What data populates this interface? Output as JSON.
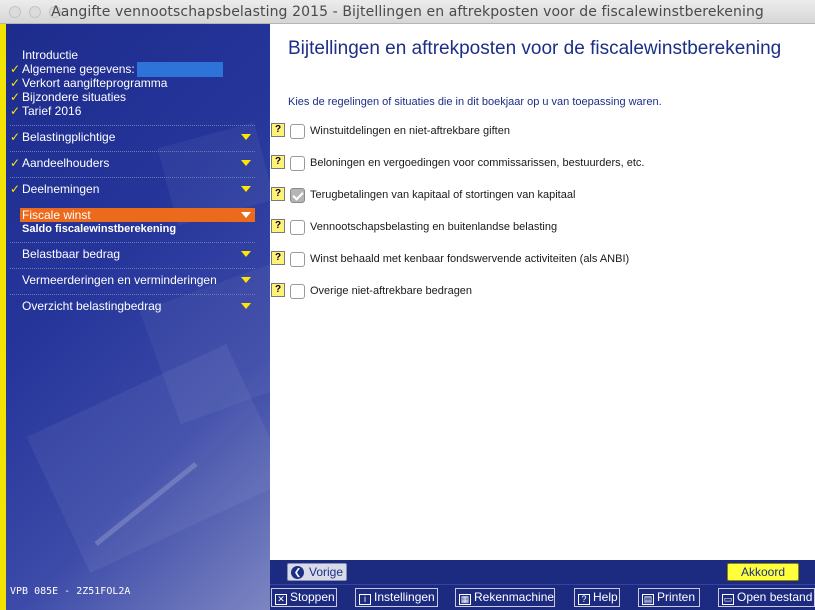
{
  "window": {
    "title": "Aangifte vennootschapsbelasting 2015 - Bijtellingen en aftrekposten voor de fiscalewinstberekening"
  },
  "sidebar": {
    "intro_items": [
      {
        "label": "Introductie",
        "checked": false
      },
      {
        "label": "Algemene gegevens:",
        "checked": true
      },
      {
        "label": "Verkort aangifteprogramma",
        "checked": true
      },
      {
        "label": "Bijzondere situaties",
        "checked": true
      },
      {
        "label": "Tarief 2016",
        "checked": true
      }
    ],
    "sections": [
      {
        "label": "Belastingplichtige",
        "checked": true
      },
      {
        "label": "Aandeelhouders",
        "checked": true
      },
      {
        "label": "Deelnemingen",
        "checked": true
      }
    ],
    "active_section": {
      "label": "Fiscale winst",
      "sub_label": "Saldo fiscalewinstberekening"
    },
    "lower_sections": [
      {
        "label": "Belastbaar bedrag"
      },
      {
        "label": "Vermeerderingen en verminderingen"
      },
      {
        "label": "Overzicht belastingbedrag"
      }
    ],
    "version": "VPB 085E - 2Z51FOL2A"
  },
  "main": {
    "title": "Bijtellingen en aftrekposten voor de fiscalewinstberekening",
    "instruction": "Kies de regelingen of situaties die in dit boekjaar op u van toepassing waren.",
    "help_label": "?",
    "options": [
      {
        "label": "Winstuitdelingen en niet-aftrekbare giften",
        "checked": false
      },
      {
        "label": "Beloningen en vergoedingen voor commissarissen, bestuurders, etc.",
        "checked": false
      },
      {
        "label": "Terugbetalingen van kapitaal of stortingen van kapitaal",
        "checked": true
      },
      {
        "label": "Vennootschapsbelasting en buitenlandse belasting",
        "checked": false
      },
      {
        "label": "Winst behaald met kenbaar fondswervende activiteiten (als ANBI)",
        "checked": false
      },
      {
        "label": "Overige niet-aftrekbare bedragen",
        "checked": false
      }
    ]
  },
  "navigation": {
    "prev_label": "Vorige",
    "ok_label": "Akkoord"
  },
  "toolbar": {
    "buttons": [
      {
        "label": "Stoppen",
        "icon": "x-box-icon"
      },
      {
        "label": "Instellingen",
        "icon": "info-icon"
      },
      {
        "label": "Rekenmachine",
        "icon": "calculator-icon"
      },
      {
        "label": "Help",
        "icon": "help-icon"
      },
      {
        "label": "Printen",
        "icon": "printer-icon"
      },
      {
        "label": "Open bestand",
        "icon": "folder-icon"
      }
    ]
  },
  "colors": {
    "sidebar_bg": "#1d2c8c",
    "accent_yellow": "#ffe600",
    "active_orange": "#ec6a1b",
    "title_blue": "#1b2f86"
  }
}
